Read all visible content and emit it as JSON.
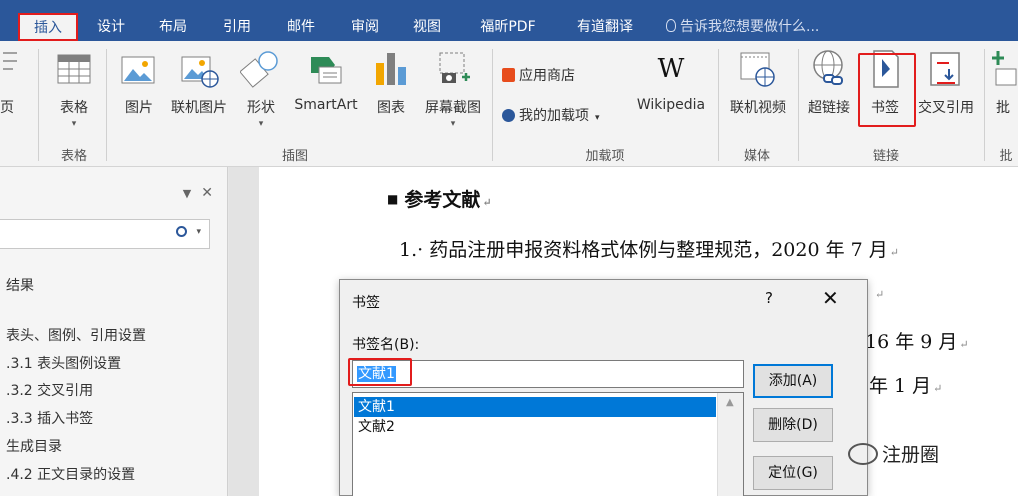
{
  "ribbon_tabs": [
    "插入",
    "设计",
    "布局",
    "引用",
    "邮件",
    "审阅",
    "视图",
    "福昕PDF",
    "有道翻译"
  ],
  "tell_me": "告诉我您想要做什么...",
  "ribbon": {
    "page_partial": "页",
    "table": "表格",
    "picture": "图片",
    "online_picture": "联机图片",
    "shapes": "形状",
    "smartart": "SmartArt",
    "chart": "图表",
    "screenshot": "屏幕截图",
    "app_store": "应用商店",
    "my_addins": "我的加载项",
    "wikipedia": "Wikipedia",
    "online_video": "联机视频",
    "hyperlink": "超链接",
    "bookmark": "书签",
    "cross_ref": "交叉引用",
    "annotation_partial": "批",
    "group_tables": "表格",
    "group_illustrations": "插图",
    "group_addins": "加载项",
    "group_media": "媒体",
    "group_links": "链接",
    "group_comments_partial": "批"
  },
  "nav": {
    "close": "✕",
    "results": "结果",
    "items": [
      "表头、图例、引用设置",
      ".3.1 表头图例设置",
      ".3.2 交叉引用",
      ".3.3 插入书签",
      "生成目录",
      ".4.2 正文目录的设置"
    ]
  },
  "doc": {
    "heading": "参考文献",
    "line1": "1.· 药品注册申报资料格式体例与整理规范，2020 年 7 月",
    "line3_tail": "16 年 9 月",
    "line4_tail": "年 1 月"
  },
  "dialog": {
    "title": "书签",
    "help": "?",
    "close": "✕",
    "field_label": "书签名(B):",
    "name_value": "文献1",
    "list": [
      "文献1",
      "文献2"
    ],
    "btn_add": "添加(A)",
    "btn_delete": "删除(D)",
    "btn_goto": "定位(G)"
  },
  "watermark": "注册圈",
  "colors": {
    "ribbon_blue": "#2b579a",
    "highlight_red": "#e21c1c",
    "select_blue": "#0078d7"
  }
}
